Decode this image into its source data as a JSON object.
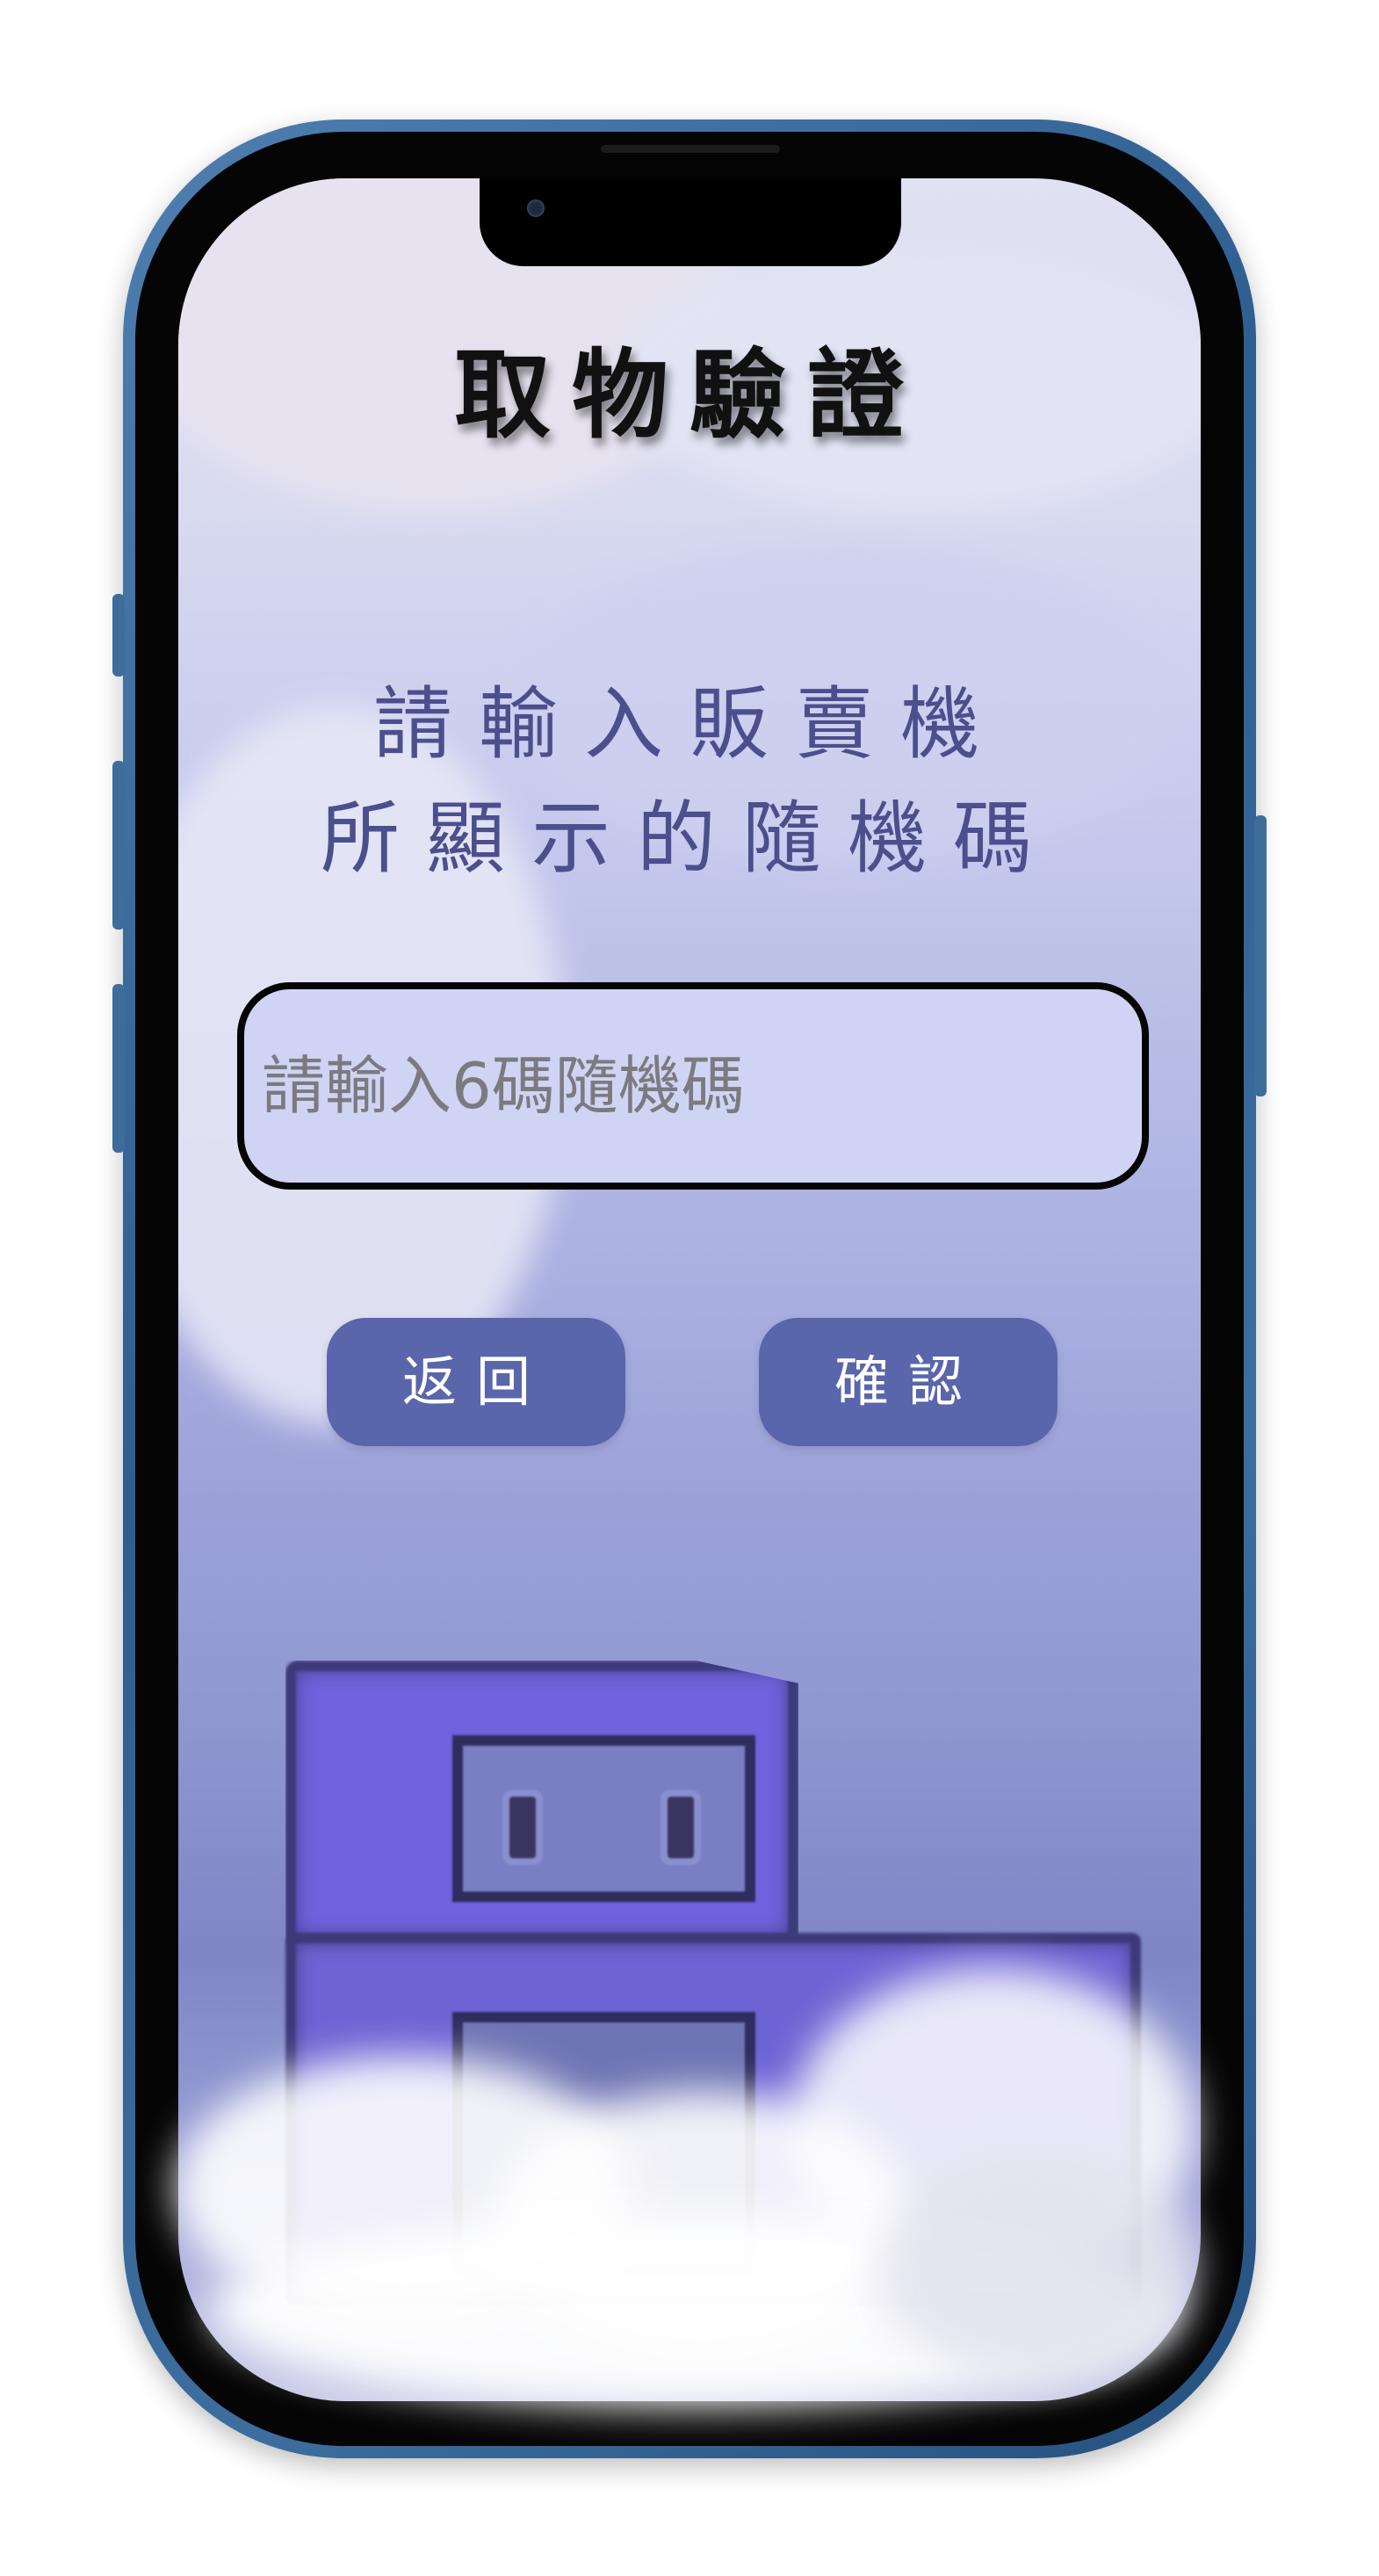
{
  "screen": {
    "title": "取物驗證",
    "instruction_line1": "請輸入販賣機",
    "instruction_line2": "所顯示的隨機碼",
    "code_input": {
      "value": "",
      "placeholder": "請輸入6碼隨機碼"
    },
    "buttons": {
      "back_label": "返回",
      "confirm_label": "確認"
    }
  },
  "theme": {
    "frame_color": "#3a6a9a",
    "button_color": "#5966ab",
    "title_color": "#111111",
    "instruction_color": "#4b4f8d",
    "input_background": "#cfd4f4"
  },
  "icons": {
    "camera": "front-camera-icon",
    "mascot": "robot-mascot-icon"
  }
}
